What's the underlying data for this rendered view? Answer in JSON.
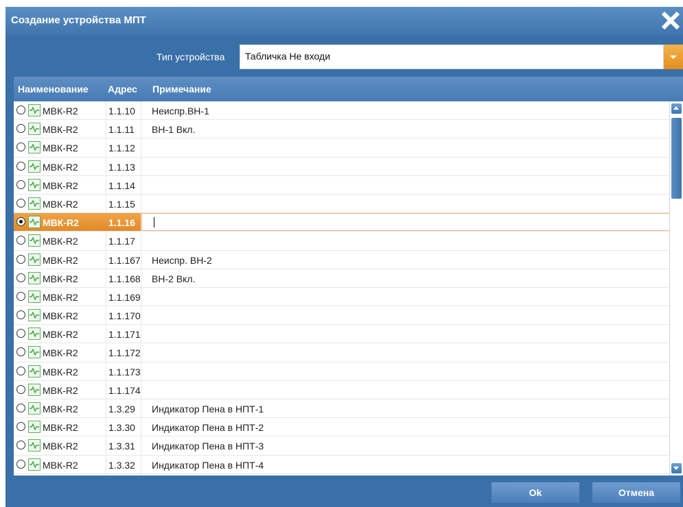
{
  "dialog": {
    "title": "Создание устройства МПТ",
    "close_icon": "close-icon"
  },
  "device_type": {
    "label": "Тип устройства",
    "value": "Табличка Не входи"
  },
  "grid": {
    "columns": [
      "Наименование",
      "Адрес",
      "Примечание"
    ],
    "rows": [
      {
        "name": "МВК-R2",
        "address": "1.1.10",
        "note": "Неиспр.ВН-1",
        "selected": false
      },
      {
        "name": "МВК-R2",
        "address": "1.1.11",
        "note": "ВН-1 Вкл.",
        "selected": false
      },
      {
        "name": "МВК-R2",
        "address": "1.1.12",
        "note": "",
        "selected": false
      },
      {
        "name": "МВК-R2",
        "address": "1.1.13",
        "note": "",
        "selected": false
      },
      {
        "name": "МВК-R2",
        "address": "1.1.14",
        "note": "",
        "selected": false
      },
      {
        "name": "МВК-R2",
        "address": "1.1.15",
        "note": "",
        "selected": false
      },
      {
        "name": "МВК-R2",
        "address": "1.1.16",
        "note": "",
        "selected": true
      },
      {
        "name": "МВК-R2",
        "address": "1.1.17",
        "note": "",
        "selected": false
      },
      {
        "name": "МВК-R2",
        "address": "1.1.167",
        "note": "Неиспр. ВН-2",
        "selected": false
      },
      {
        "name": "МВК-R2",
        "address": "1.1.168",
        "note": "ВН-2 Вкл.",
        "selected": false
      },
      {
        "name": "МВК-R2",
        "address": "1.1.169",
        "note": "",
        "selected": false
      },
      {
        "name": "МВК-R2",
        "address": "1.1.170",
        "note": "",
        "selected": false
      },
      {
        "name": "МВК-R2",
        "address": "1.1.171",
        "note": "",
        "selected": false
      },
      {
        "name": "МВК-R2",
        "address": "1.1.172",
        "note": "",
        "selected": false
      },
      {
        "name": "МВК-R2",
        "address": "1.1.173",
        "note": "",
        "selected": false
      },
      {
        "name": "МВК-R2",
        "address": "1.1.174",
        "note": "",
        "selected": false
      },
      {
        "name": "МВК-R2",
        "address": "1.3.29",
        "note": "Индикатор Пена в НПТ-1",
        "selected": false
      },
      {
        "name": "МВК-R2",
        "address": "1.3.30",
        "note": "Индикатор Пена в НПТ-2",
        "selected": false
      },
      {
        "name": "МВК-R2",
        "address": "1.3.31",
        "note": "Индикатор Пена в НПТ-3",
        "selected": false
      },
      {
        "name": "МВК-R2",
        "address": "1.3.32",
        "note": "Индикатор Пена в НПТ-4",
        "selected": false
      }
    ]
  },
  "buttons": {
    "ok": "Ok",
    "cancel": "Отмена"
  },
  "colors": {
    "dialog_bg": "#3a70a8",
    "selection": "#e28a28",
    "accent_arrow": "#e58f1f"
  }
}
